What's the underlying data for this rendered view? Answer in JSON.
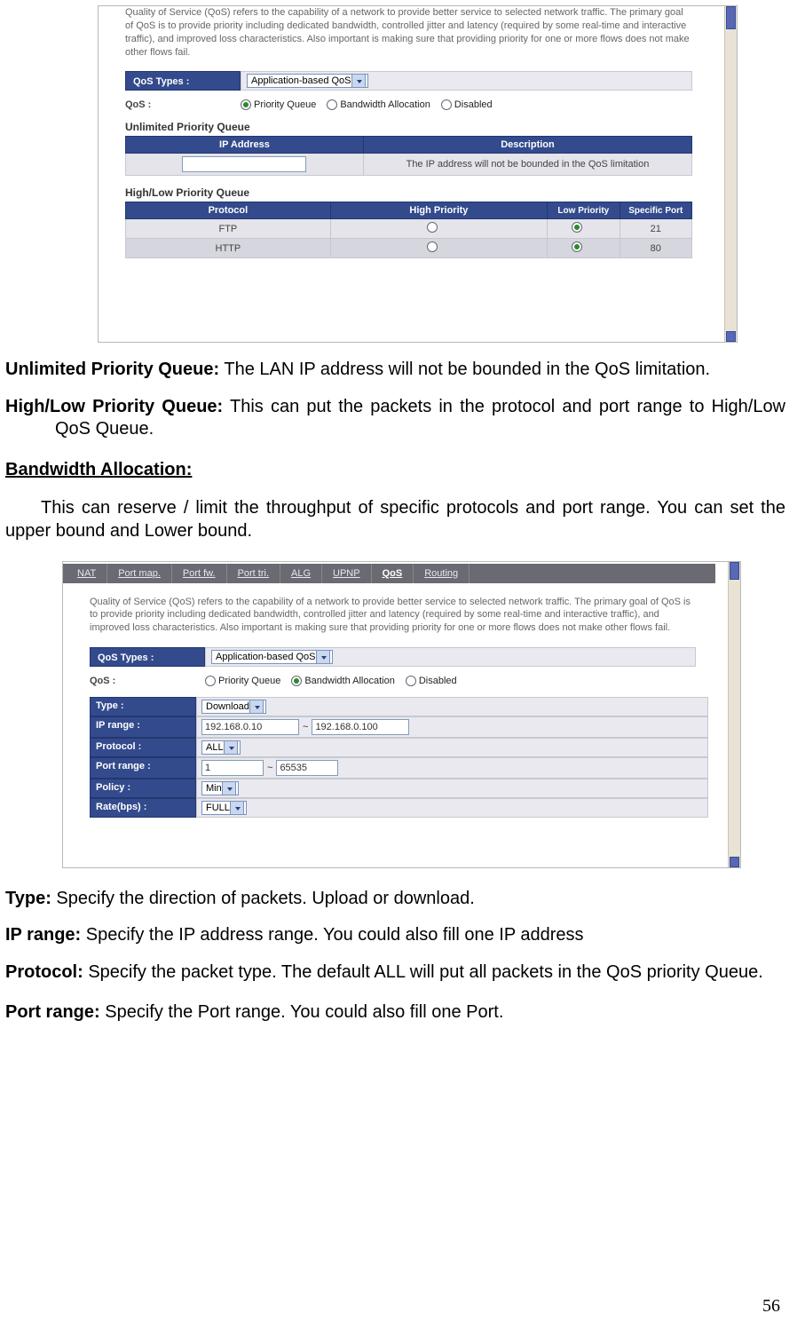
{
  "page_number": "56",
  "shot1": {
    "qos_desc": "Quality of Service (QoS) refers to the capability of a network to provide better service to selected network traffic. The primary goal of QoS is to provide priority including dedicated bandwidth, controlled jitter and latency (required by some real-time and interactive traffic), and improved loss characteristics. Also important is making sure that providing priority for one or more flows does not make other flows fail.",
    "types_label": "QoS Types :",
    "types_value": "Application-based QoS",
    "qos_label": "QoS :",
    "opt_priority": "Priority Queue",
    "opt_bandwidth": "Bandwidth Allocation",
    "opt_disabled": "Disabled",
    "unlimited_title": "Unlimited Priority Queue",
    "th_ip": "IP Address",
    "th_desc": "Description",
    "ip_desc_text": "The IP address will not be bounded in the QoS limitation",
    "hl_title": "High/Low Priority Queue",
    "th_proto": "Protocol",
    "th_high": "High Priority",
    "th_low": "Low Priority",
    "th_port": "Specific Port",
    "row_ftp": "FTP",
    "row_ftp_port": "21",
    "row_http": "HTTP",
    "row_http_port": "80"
  },
  "doc1": {
    "upq_label": "Unlimited Priority Queue:",
    "upq_text": " The LAN IP address will not be bounded in the QoS limitation.",
    "hlq_label": "High/Low Priority Queue:",
    "hlq_text": " This can put the packets in the protocol and port range to High/Low QoS Queue.",
    "ba_title": "Bandwidth Allocation:",
    "ba_text": "This can reserve / limit the throughput of specific protocols and port range. You can set the upper bound and Lower bound."
  },
  "shot2": {
    "tabs": {
      "nat": "NAT",
      "pmap": "Port map.",
      "pfw": "Port fw.",
      "ptri": "Port tri.",
      "alg": "ALG",
      "upnp": "UPNP",
      "qos": "QoS",
      "routing": "Routing"
    },
    "types_label": "QoS Types :",
    "types_value": "Application-based QoS",
    "qos_label": "QoS :",
    "opt_priority": "Priority Queue",
    "opt_bandwidth": "Bandwidth Allocation",
    "opt_disabled": "Disabled",
    "f_type_label": "Type :",
    "f_type_value": "Download",
    "f_ip_label": "IP range :",
    "f_ip_from": "192.168.0.10",
    "f_ip_sep": "~",
    "f_ip_to": "192.168.0.100",
    "f_proto_label": "Protocol :",
    "f_proto_value": "ALL",
    "f_port_label": "Port range :",
    "f_port_from": "1",
    "f_port_sep": "~",
    "f_port_to": "65535",
    "f_policy_label": "Policy :",
    "f_policy_value": "Min",
    "f_rate_label": "Rate(bps) :",
    "f_rate_value": "FULL"
  },
  "doc2": {
    "type_label": "Type:",
    "type_text": " Specify the direction of packets. Upload or download.",
    "ip_label": "IP range:",
    "ip_text": " Specify the IP address range. You could also fill one IP address",
    "proto_label": "Protocol:",
    "proto_text": " Specify the packet type. The default ALL will put all packets in the QoS priority Queue.",
    "port_label": "Port range:",
    "port_text": " Specify the Port range. You could also fill one Port."
  }
}
